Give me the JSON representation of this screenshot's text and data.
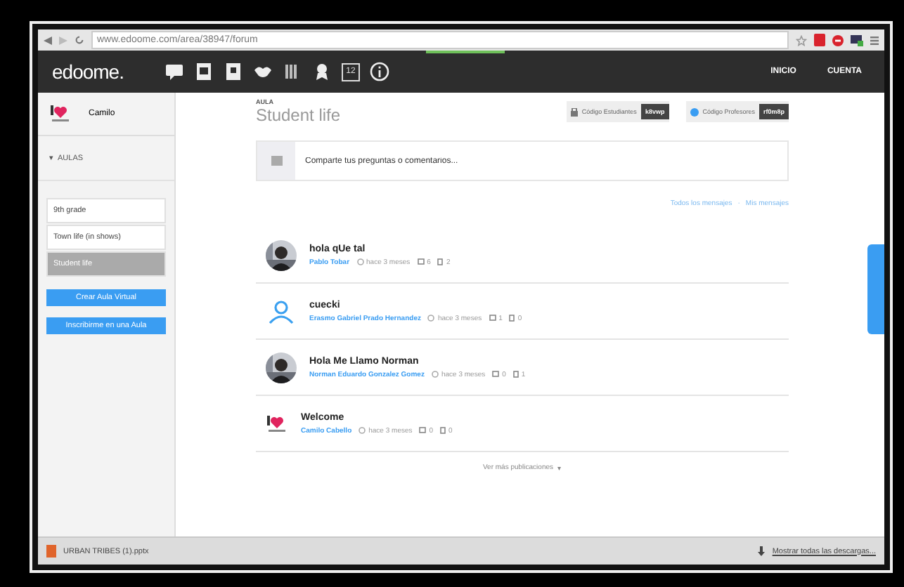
{
  "browser": {
    "url": "www.edoome.com/area/38947/forum"
  },
  "navbar": {
    "logo": "edoome.",
    "calendar_day": "12",
    "links": [
      "INICIO",
      "CUENTA"
    ]
  },
  "sidebar": {
    "user": "Camilo",
    "section": {
      "label": "AULAS",
      "expanded": true
    },
    "classes": [
      {
        "name": "9th grade",
        "selected": false
      },
      {
        "name": "Town life (in shows)",
        "selected": false
      },
      {
        "name": "Student life",
        "selected": true
      }
    ],
    "buttons": [
      "Crear Aula Virtual",
      "Inscribirme en una Aula"
    ]
  },
  "class_header": {
    "kicker": "AULA",
    "title": "Student life",
    "codes": [
      {
        "label": "Código Estudiantes",
        "code": "k8vwp",
        "kind": "student"
      },
      {
        "label": "Código Profesores",
        "code": "rf0m8p",
        "kind": "teacher"
      }
    ]
  },
  "composer": {
    "placeholder": "Comparte tus preguntas o comentarios..."
  },
  "filters": [
    {
      "label": "Todos los mensajes",
      "selected": false
    },
    {
      "label": "Mis mensajes",
      "selected": false
    }
  ],
  "filter_separator": "·",
  "posts": [
    {
      "title": "hola qUe tal",
      "author": "Pablo Tobar",
      "time": "hace 3 meses",
      "comments": "6",
      "files": "2"
    },
    {
      "title": "cuecki",
      "author": "Erasmo Gabriel Prado Hernandez",
      "time": "hace 3 meses",
      "comments": "1",
      "files": "0",
      "kind": "default"
    },
    {
      "title": "Hola Me Llamo Norman",
      "author": "Norman Eduardo Gonzalez Gomez",
      "time": "hace 3 meses",
      "comments": "0",
      "files": "1"
    },
    {
      "title": "Welcome",
      "author": "Camilo Cabello",
      "time": "hace 3 meses",
      "comments": "0",
      "files": "0",
      "kind": "logo"
    }
  ],
  "more": {
    "label": "Ver más publicaciones",
    "arrow": "▾"
  },
  "downloads": {
    "file": "URBAN TRIBES (1).pptx",
    "show_all": "Mostrar todas las descargas..."
  }
}
